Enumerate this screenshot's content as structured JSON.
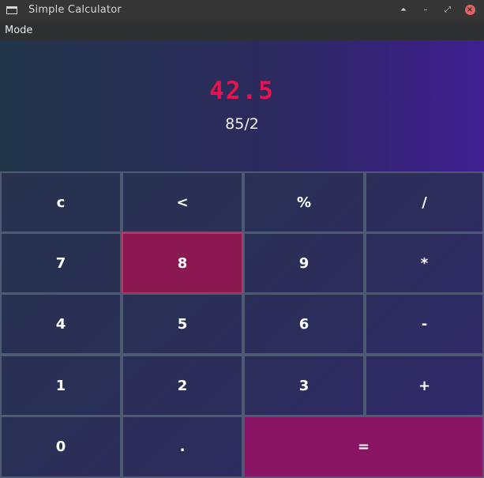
{
  "window": {
    "title": "Simple Calculator",
    "controls": {
      "minimize": "–",
      "maximize": "⤢",
      "close": "×",
      "shade": "⏶"
    }
  },
  "menu": {
    "items": [
      "Mode"
    ]
  },
  "display": {
    "result": "42.5",
    "expression": "85/2",
    "result_color": "#e5134f"
  },
  "keypad": {
    "keys": [
      "c",
      "<",
      "%",
      "/",
      "7",
      "8",
      "9",
      "*",
      "4",
      "5",
      "6",
      "-",
      "1",
      "2",
      "3",
      "+",
      "0",
      ".",
      "="
    ],
    "highlighted_key": "8",
    "highlight_color": "#8c1852",
    "equals_color": "#8a1565"
  }
}
